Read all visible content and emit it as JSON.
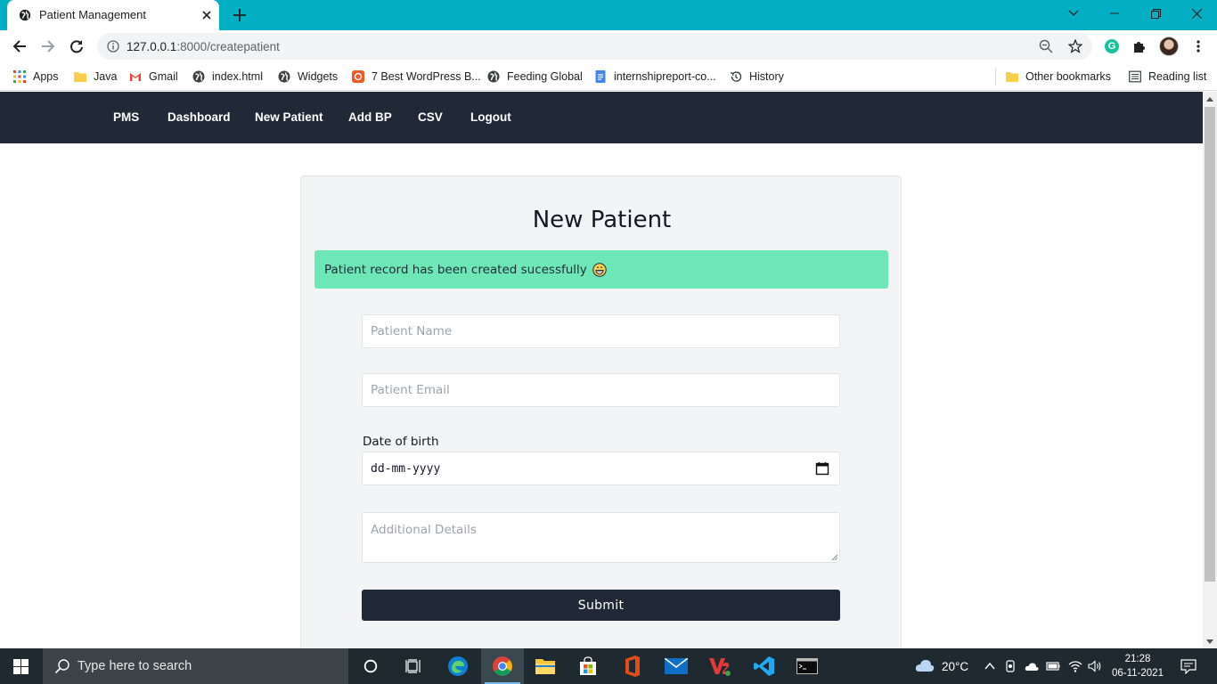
{
  "browser": {
    "tab_title": "Patient Management",
    "url_host": "127.0.0.1",
    "url_rest": ":8000/createpatient"
  },
  "bookmarks": {
    "apps": "Apps",
    "items": [
      "Java",
      "Gmail",
      "index.html",
      "Widgets",
      "7 Best WordPress B...",
      "Feeding Global",
      "internshipreport-co...",
      "History"
    ],
    "other": "Other bookmarks",
    "reading_list": "Reading list"
  },
  "nav": {
    "brand": "PMS",
    "links": [
      "Dashboard",
      "New Patient",
      "Add BP",
      "CSV",
      "Logout"
    ]
  },
  "form": {
    "title": "New Patient",
    "alert": "Patient record has been created sucessfully",
    "name_placeholder": "Patient Name",
    "email_placeholder": "Patient Email",
    "dob_label": "Date of birth",
    "dob_value": "dd-mm-yyyy",
    "details_placeholder": "Additional Details",
    "submit": "Submit"
  },
  "taskbar": {
    "search_placeholder": "Type here to search",
    "weather": "20°C",
    "time": "21:28",
    "date": "06-11-2021"
  },
  "colors": {
    "tab_strip": "#00afc4",
    "navbar": "#1f2937",
    "alert_bg": "#6ee7b7",
    "card_bg": "#f3f4f6",
    "taskbar": "#1f2a30"
  }
}
